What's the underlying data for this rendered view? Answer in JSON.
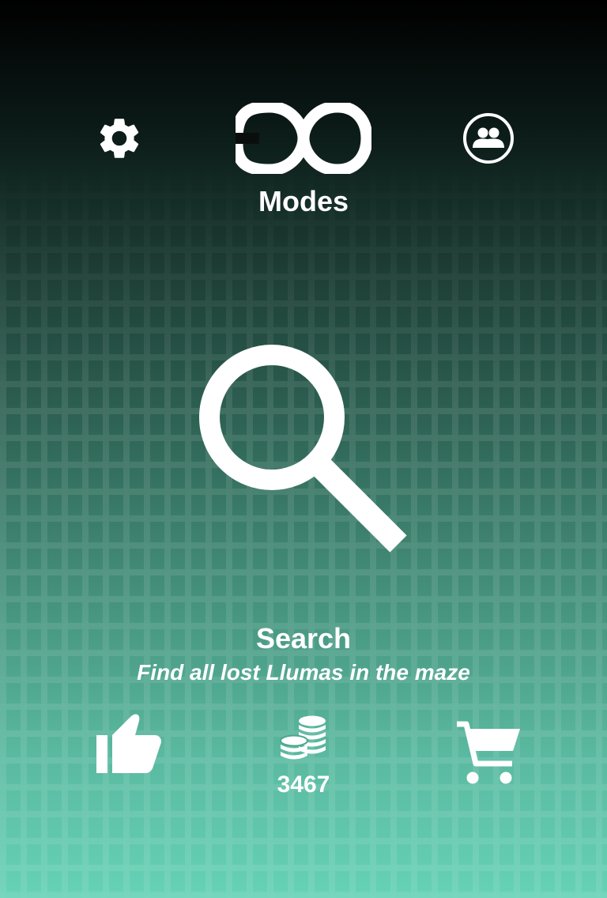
{
  "header": {
    "modes_label": "Modes",
    "settings_icon": "gear-icon",
    "modes_icon": "infinity-icon",
    "friends_icon": "people-circle-icon"
  },
  "mode": {
    "icon": "magnifier-icon",
    "title": "Search",
    "description": "Find all lost Llumas in the maze"
  },
  "footer": {
    "like_icon": "thumbs-up-icon",
    "coins_icon": "coin-stack-icon",
    "coins": "3467",
    "shop_icon": "shopping-cart-icon"
  },
  "colors": {
    "top": "#000000",
    "bottom": "#66d2b6",
    "foreground": "#ffffff"
  }
}
